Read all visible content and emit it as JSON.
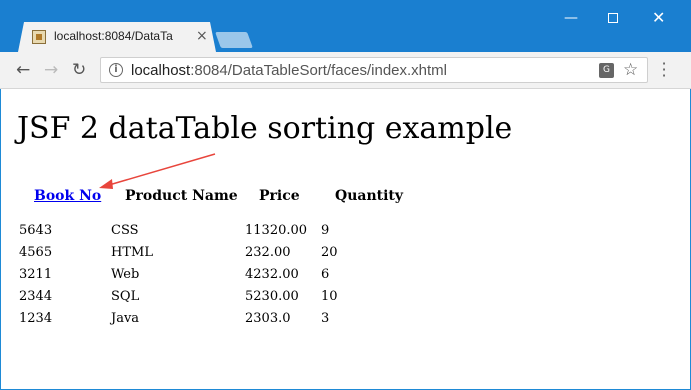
{
  "browser": {
    "tab_title": "localhost:8084/DataTa",
    "tab_close": "×",
    "url_host": "localhost",
    "url_rest": ":8084/DataTableSort/faces/index.xhtml",
    "icons": {
      "back": "arrow-left-icon",
      "forward": "arrow-right-icon",
      "reload": "reload-icon",
      "info": "info-icon",
      "translate": "translate-icon",
      "bookmark": "star-icon",
      "menu": "kebab-menu-icon"
    },
    "window_controls": {
      "minimize": "—",
      "close": "✕"
    }
  },
  "page": {
    "title": "JSF 2 dataTable sorting example",
    "columns": [
      "Book No",
      "Product Name",
      "Price",
      "Quantity"
    ],
    "rows": [
      {
        "no": "5643",
        "name": "CSS",
        "price": "11320.00",
        "qty": "9"
      },
      {
        "no": "4565",
        "name": "HTML",
        "price": "232.00",
        "qty": "20"
      },
      {
        "no": "3211",
        "name": "Web",
        "price": "4232.00",
        "qty": "6"
      },
      {
        "no": "2344",
        "name": "SQL",
        "price": "5230.00",
        "qty": "10"
      },
      {
        "no": "1234",
        "name": "Java",
        "price": "2303.0",
        "qty": "3"
      }
    ],
    "annotation_color": "#e8453c"
  }
}
